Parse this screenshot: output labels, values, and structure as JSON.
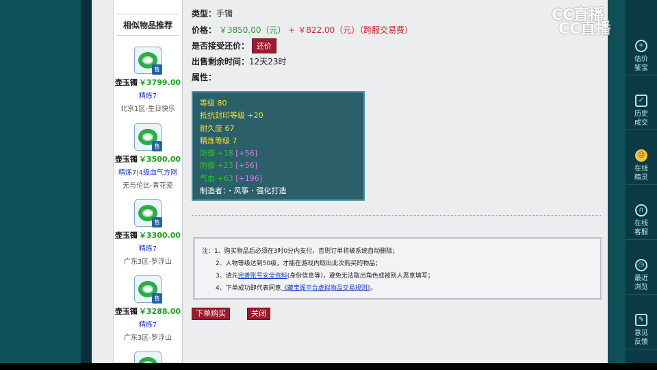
{
  "watermark": {
    "line1": "CC直播",
    "line2": "CC直播"
  },
  "recommend": {
    "title": "相似物品推荐",
    "items": [
      {
        "name": "壶玉镯",
        "price": "￥3799.00",
        "refine": "精炼7",
        "server": "北京1区-生日快乐",
        "tag": "售"
      },
      {
        "name": "壶玉镯",
        "price": "￥3500.00",
        "refine": "精炼7|4级血气方刚",
        "server": "无与伦比-青花瓷",
        "tag": "售"
      },
      {
        "name": "壶玉镯",
        "price": "￥3300.00",
        "refine": "精炼7",
        "server": "广东3区-罗浮山",
        "tag": "售"
      },
      {
        "name": "壶玉镯",
        "price": "￥3288.00",
        "refine": "精炼7",
        "server": "广东3区-罗浮山",
        "tag": "售"
      },
      {
        "name": "",
        "price": "",
        "refine": "",
        "server": "",
        "tag": ""
      }
    ]
  },
  "detail": {
    "type_label": "类型：",
    "type_value": "手镯",
    "price_label": "价格：",
    "price_main": "￥3850.00（元）",
    "price_plus": "+",
    "price_fee": "￥822.00（元）（跨服交易费）",
    "counter_label": "是否接受还价：",
    "counter_button": "还价",
    "time_label": "出售剩余时间：",
    "time_value": "12天23时",
    "attr_label": "属性："
  },
  "attributes": [
    {
      "text": "等级 80",
      "color": "#f0e22a"
    },
    {
      "text": "抵抗封印等级 +20",
      "color": "#f0e22a"
    },
    {
      "text": "耐久度 67",
      "color": "#f0e22a"
    },
    {
      "text": "精炼等级 7",
      "color": "#f0e22a"
    },
    {
      "text": "防御 +18",
      "extra": "[+56]",
      "color": "#24c92a"
    },
    {
      "text": "防御 +23",
      "extra": "[+56]",
      "color": "#24c92a"
    },
    {
      "text": "气血 +63",
      "extra": "[+196]",
      "color": "#24c92a"
    },
    {
      "text": "制造者：・风筝・强化打造",
      "color": "#ffffff"
    }
  ],
  "notice": {
    "line1": "注：1、购买物品后必须在3时0分内支付，否则订单将被系统自动删除；",
    "line2": "2、人物等级达到50级，才能在游戏内取出此次购买的物品；",
    "line3_pre": "3、请先",
    "line3_link": "完善账号安全资料",
    "line3_post": "(身份信息等)，避免无法取出角色或被别人恶意填写；",
    "line4_pre": "4、下单成功即代表同意",
    "line4_link": "《藏宝阁平台虚拟物品交易规则》",
    "line4_post": "。"
  },
  "actions": {
    "order": "下单购买",
    "close": "关闭"
  },
  "sidebar": [
    {
      "icon": "plus-icon",
      "glyph": "+",
      "l1": "估价",
      "l2": "鉴宝"
    },
    {
      "icon": "shield-icon",
      "glyph": "✓",
      "l1": "历史",
      "l2": "成交"
    },
    {
      "icon": "avatar-icon",
      "glyph": "☺",
      "l1": "在线",
      "l2": "精灵"
    },
    {
      "icon": "headset-icon",
      "glyph": "∩",
      "l1": "在线",
      "l2": "客服"
    },
    {
      "icon": "clock-icon",
      "glyph": "◷",
      "l1": "最近",
      "l2": "浏览"
    },
    {
      "icon": "edit-icon",
      "glyph": "✎",
      "l1": "意见",
      "l2": "反馈"
    }
  ]
}
